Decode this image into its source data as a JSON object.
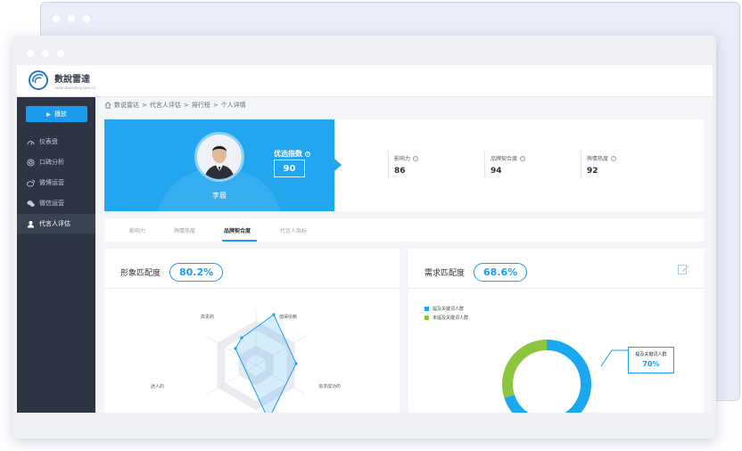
{
  "brand": {
    "name": "數說雷達",
    "subtitle": "radar.datastory.com.cn",
    "accent_color": "#1a9df0"
  },
  "sidebar": {
    "play_button_label": "播放",
    "items": [
      {
        "label": "仪表盘",
        "icon": "dashboard-icon"
      },
      {
        "label": "口碑分析",
        "icon": "target-icon"
      },
      {
        "label": "微博运营",
        "icon": "weibo-icon"
      },
      {
        "label": "微信运营",
        "icon": "wechat-icon"
      },
      {
        "label": "代言人评估",
        "icon": "user-icon",
        "active": true
      }
    ]
  },
  "breadcrumb": [
    "数说雷达",
    "代言人评估",
    "排行榜",
    "个人详情"
  ],
  "profile": {
    "name": "李晨",
    "score_label": "优选指数",
    "score_value": "90",
    "metrics": [
      {
        "label": "影响力",
        "value": "86"
      },
      {
        "label": "品牌契合度",
        "value": "94"
      },
      {
        "label": "舆情热度",
        "value": "92"
      }
    ]
  },
  "tabs": [
    {
      "label": "影响力",
      "active": false
    },
    {
      "label": "舆情热度",
      "active": false
    },
    {
      "label": "品牌契合度",
      "active": true
    },
    {
      "label": "代言人指标",
      "active": false
    }
  ],
  "image_match": {
    "title": "形象匹配度",
    "percent": "80.2%",
    "radar_labels": [
      "高贵的",
      "值得信赖",
      "追求成功的",
      "迷人的"
    ]
  },
  "demand_match": {
    "title": "需求匹配度",
    "percent": "68.6%",
    "legend": [
      {
        "label": "提及关键词人群",
        "color": "#1aa8f0"
      },
      {
        "label": "未提及关键词人群",
        "color": "#8cc63f"
      }
    ],
    "callout_label": "提及关键词人群",
    "callout_value": "70%",
    "chart_data": {
      "type": "pie",
      "categories": [
        "提及关键词人群",
        "未提及关键词人群"
      ],
      "values": [
        70,
        30
      ],
      "colors": [
        "#1aa8f0",
        "#8cc63f"
      ]
    }
  }
}
